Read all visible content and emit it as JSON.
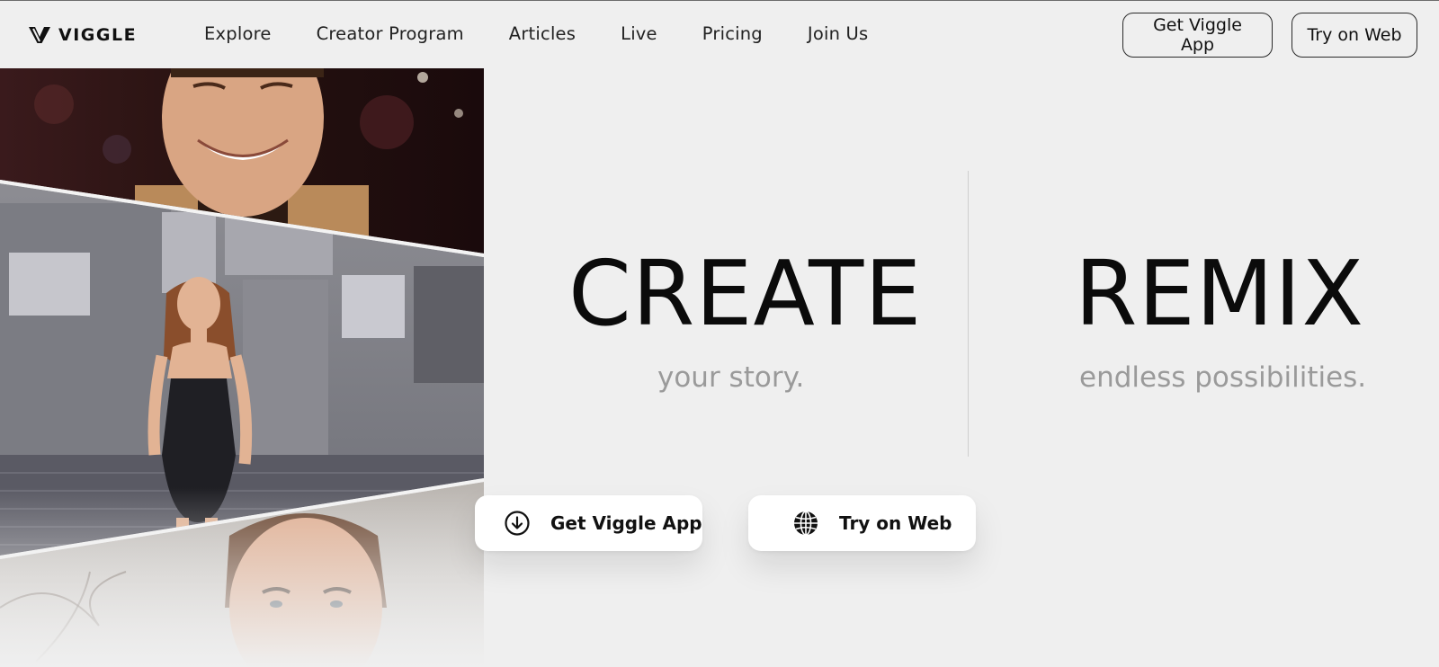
{
  "brand": {
    "name": "VIGGLE"
  },
  "nav": {
    "items": [
      {
        "label": "Explore"
      },
      {
        "label": "Creator Program"
      },
      {
        "label": "Articles"
      },
      {
        "label": "Live"
      },
      {
        "label": "Pricing"
      },
      {
        "label": "Join Us"
      }
    ]
  },
  "header_actions": {
    "get_app_label": "Get Viggle App",
    "try_web_label": "Try on Web"
  },
  "hero": {
    "left_word": "CREATE",
    "left_sub": "your story.",
    "right_word": "REMIX",
    "right_sub": "endless possibilities."
  },
  "cta": {
    "get_app_label": "Get Viggle App",
    "get_app_icon": "download-circle-icon",
    "try_web_label": "Try on Web",
    "try_web_icon": "globe-icon"
  },
  "colors": {
    "background": "#efefef",
    "text": "#111111",
    "subtext": "#9a9a9a"
  }
}
